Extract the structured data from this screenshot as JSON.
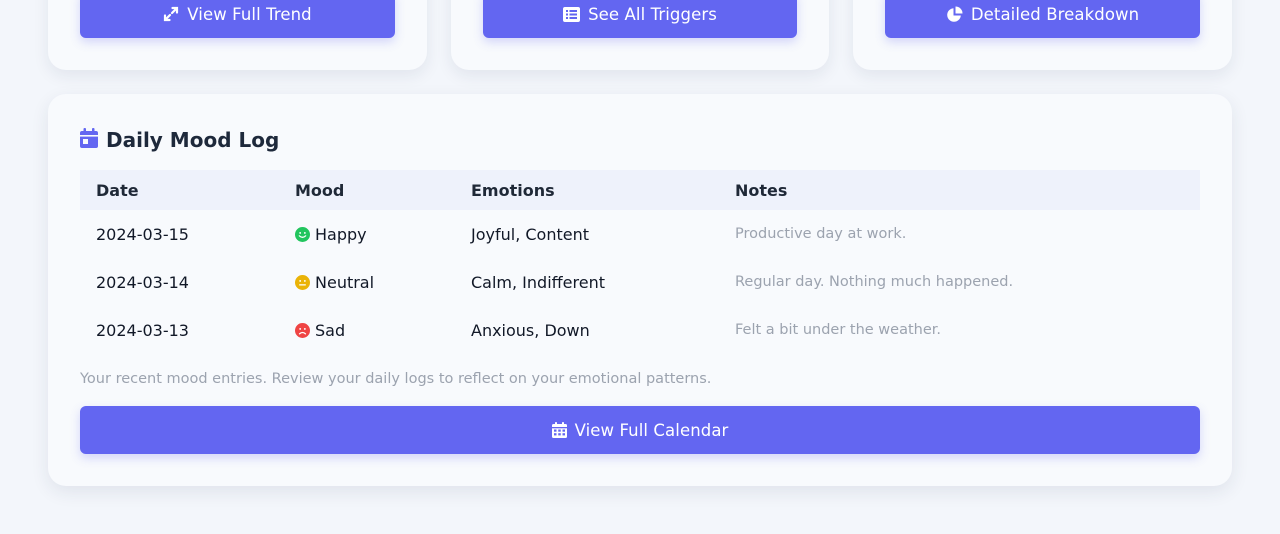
{
  "top_buttons": {
    "trend": "View Full Trend",
    "triggers": "See All Triggers",
    "breakdown": "Detailed Breakdown"
  },
  "mood_log": {
    "title": "Daily Mood Log",
    "columns": [
      "Date",
      "Mood",
      "Emotions",
      "Notes"
    ],
    "rows": [
      {
        "date": "2024-03-15",
        "mood": "Happy",
        "mood_icon": "happy-face-icon",
        "mood_color": "#22c55e",
        "emotions": "Joyful, Content",
        "notes": "Productive day at work."
      },
      {
        "date": "2024-03-14",
        "mood": "Neutral",
        "mood_icon": "neutral-face-icon",
        "mood_color": "#eab308",
        "emotions": "Calm, Indifferent",
        "notes": "Regular day. Nothing much happened."
      },
      {
        "date": "2024-03-13",
        "mood": "Sad",
        "mood_icon": "sad-face-icon",
        "mood_color": "#ef4444",
        "emotions": "Anxious, Down",
        "notes": "Felt a bit under the weather."
      }
    ],
    "caption": "Your recent mood entries. Review your daily logs to reflect on your emotional patterns.",
    "calendar_button": "View Full Calendar"
  },
  "colors": {
    "accent": "#6366f1",
    "background": "#f3f6fb",
    "card": "#f8fafd",
    "table_header": "#eef2fb"
  }
}
